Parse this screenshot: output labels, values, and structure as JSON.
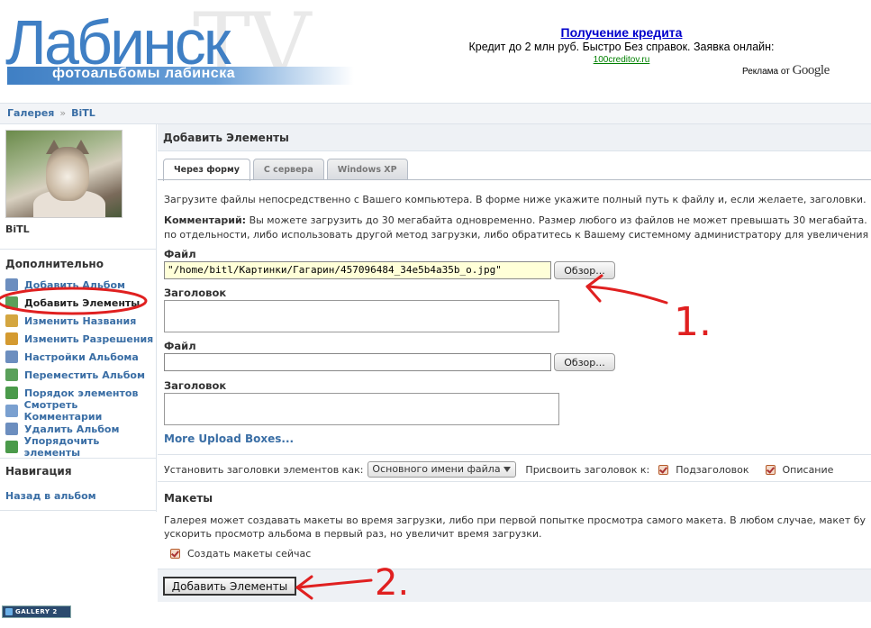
{
  "header": {
    "logo_name": "Лабинск",
    "logo_tv": "TV",
    "logo_subtitle": "фотоальбомы лабинска"
  },
  "ad": {
    "title": "Получение кредита",
    "text": "Кредит до 2 млн руб. Быстро Без справок. Заявка онлайн:",
    "url": "100creditov.ru",
    "google_prefix": "Реклама от",
    "google_brand": "Google"
  },
  "breadcrumb": {
    "items": [
      "Галерея",
      "BiTL"
    ],
    "separator": "»"
  },
  "sidebar": {
    "username": "BiTL",
    "extra_heading": "Дополнительно",
    "links": [
      {
        "label": "Добавить Альбом",
        "icon": "add-album-icon",
        "color": "#6c8ebf"
      },
      {
        "label": "Добавить Элементы",
        "icon": "add-items-icon",
        "color": "#5aa05a"
      },
      {
        "label": "Изменить Названия",
        "icon": "edit-captions-icon",
        "color": "#d4a640"
      },
      {
        "label": "Изменить Разрешения",
        "icon": "permissions-icon",
        "color": "#d49a30"
      },
      {
        "label": "Настройки Альбома",
        "icon": "album-settings-icon",
        "color": "#6c8ebf"
      },
      {
        "label": "Переместить Альбом",
        "icon": "move-album-icon",
        "color": "#5aa05a"
      },
      {
        "label": "Порядок элементов",
        "icon": "order-items-icon",
        "color": "#4a9a4a"
      },
      {
        "label": "Смотреть Комментарии",
        "icon": "comments-icon",
        "color": "#7aa0d0"
      },
      {
        "label": "Удалить Альбом",
        "icon": "delete-album-icon",
        "color": "#6c8ebf"
      },
      {
        "label": "Упорядочить элементы",
        "icon": "sort-items-icon",
        "color": "#4a9a4a"
      }
    ],
    "nav_heading": "Навигация",
    "back_link": "Назад в альбом"
  },
  "main": {
    "title": "Добавить Элементы",
    "tabs": [
      {
        "label": "Через форму",
        "active": true
      },
      {
        "label": "С сервера",
        "active": false
      },
      {
        "label": "Windows XP",
        "active": false
      }
    ],
    "intro": "Загрузите файлы непосредственно с Вашего компьютера. В форме ниже укажите полный путь к файлу и, если желаете, заголовки.",
    "comment_label": "Комментарий:",
    "comment_text": " Вы можете загрузить до 30 мегабайта одновременно. Размер любого из файлов не может превышать 30 мегабайта.",
    "comment_text_2": "по отдельности, либо использовать другой метод загрузки, либо обратитесь к Вашему системному администратору для увеличения",
    "file_label": "Файл",
    "caption_label": "Заголовок",
    "file1_value": "\"/home/bitl/Картинки/Гагарин/457096484_34e5b4a35b_o.jpg\"",
    "file2_value": "",
    "browse_label": "Обзор...",
    "more_upload": "More Upload Boxes...",
    "set_captions_label": "Установить заголовки элементов как:",
    "set_captions_value": "Основного имени файла",
    "assign_caption_label": "Присвоить заголовок к:",
    "option_summary": "Подзаголовок",
    "option_description": "Описание",
    "layouts_title": "Макеты",
    "layouts_text_1": "Галерея может создавать макеты во время загрузки, либо при первой попытке просмотра самого макета. В любом случае, макет бу",
    "layouts_text_2": "ускорить просмотр альбома в первый раз, но увеличит время загрузки.",
    "create_now_label": "Создать макеты сейчас",
    "submit_label": "Добавить Элементы"
  },
  "footer": {
    "badge": "GALLERY 2"
  },
  "annotations": {
    "mark1": "1.",
    "mark2": "2."
  },
  "colors": {
    "link": "#3a6ea5",
    "annotation_red": "#e02020"
  }
}
